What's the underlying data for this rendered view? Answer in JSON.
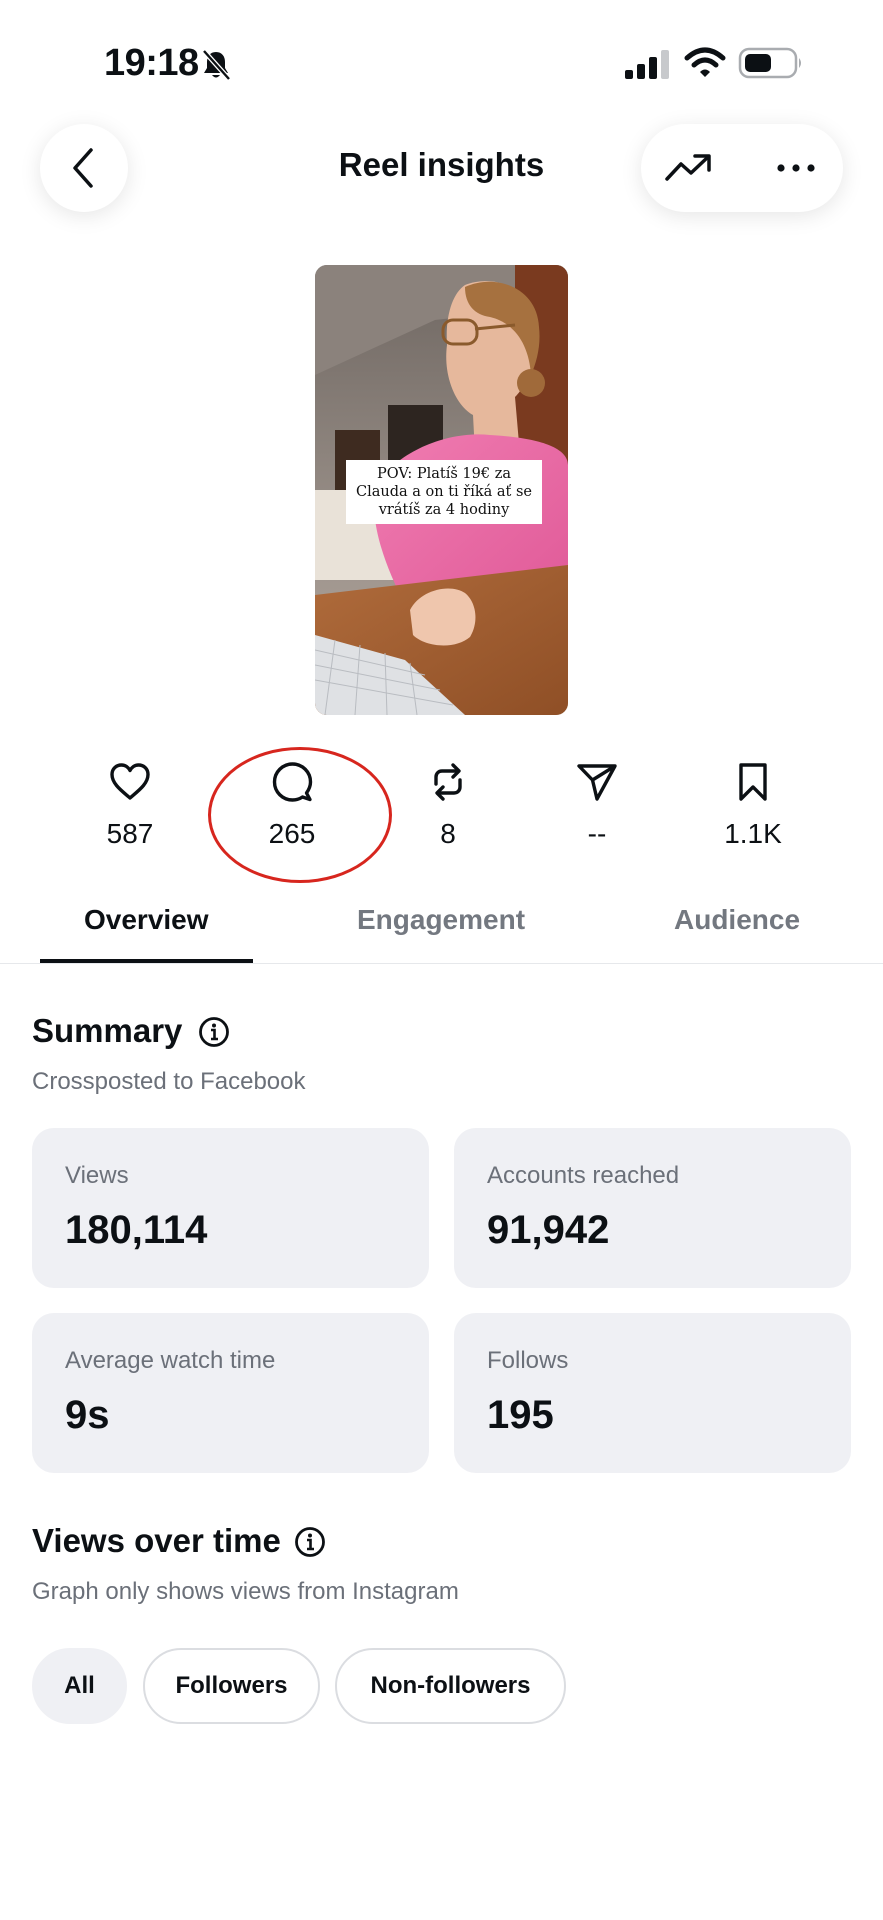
{
  "status_bar": {
    "time": "19:18",
    "icons": [
      "bell-slash-icon",
      "cellular-signal-icon",
      "wifi-icon",
      "battery-icon"
    ]
  },
  "header": {
    "title": "Reel insights",
    "back_icon": "chevron-left-icon",
    "trend_icon": "trending-up-icon",
    "more_icon": "more-horizontal-icon"
  },
  "reel": {
    "caption": "POV: Platíš 19€ za Clauda a on ti říká ať se vrátíš za 4 hodiny"
  },
  "metrics": [
    {
      "icon": "heart-icon",
      "value": "587"
    },
    {
      "icon": "comment-icon",
      "value": "265"
    },
    {
      "icon": "repost-icon",
      "value": "8"
    },
    {
      "icon": "share-icon",
      "value": "--"
    },
    {
      "icon": "bookmark-icon",
      "value": "1.1K"
    }
  ],
  "tabs": [
    {
      "label": "Overview",
      "active": true
    },
    {
      "label": "Engagement",
      "active": false
    },
    {
      "label": "Audience",
      "active": false
    }
  ],
  "summary": {
    "title": "Summary",
    "subtitle": "Crossposted to Facebook",
    "cards": [
      {
        "label": "Views",
        "value": "180,114"
      },
      {
        "label": "Accounts reached",
        "value": "91,942"
      },
      {
        "label": "Average watch time",
        "value": "9s"
      },
      {
        "label": "Follows",
        "value": "195"
      }
    ]
  },
  "views_over_time": {
    "title": "Views over time",
    "subtitle": "Graph only shows views from Instagram",
    "filters": [
      {
        "label": "All",
        "selected": true
      },
      {
        "label": "Followers",
        "selected": false
      },
      {
        "label": "Non-followers",
        "selected": false
      }
    ]
  },
  "colors": {
    "text": "#0c1014",
    "secondary_text": "#6b7079",
    "card_bg": "#eff0f4",
    "highlight_ring": "#d7261e",
    "reel_shirt": "#ec6fa6"
  }
}
